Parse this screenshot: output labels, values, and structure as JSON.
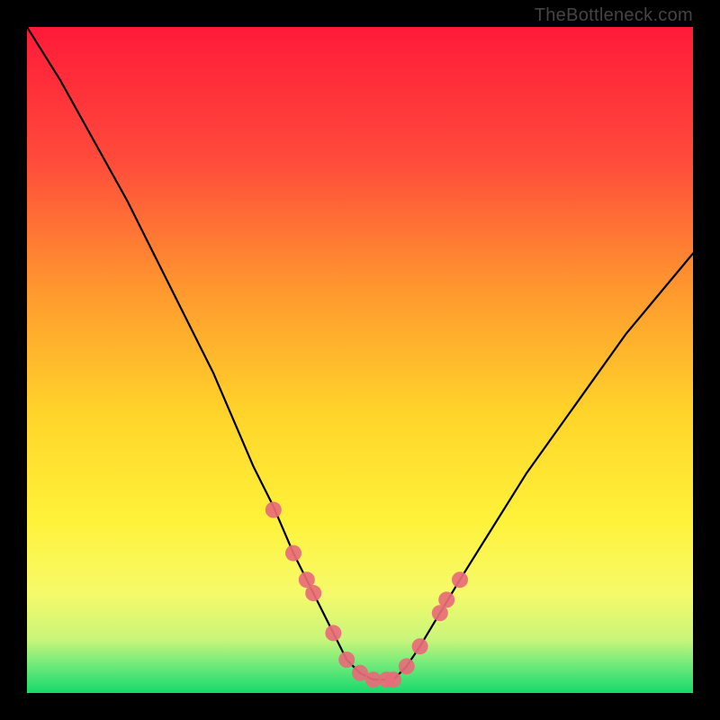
{
  "watermark": "TheBottleneck.com",
  "chart_data": {
    "type": "line",
    "title": "",
    "xlabel": "",
    "ylabel": "",
    "xlim": [
      0,
      100
    ],
    "ylim": [
      0,
      100
    ],
    "series": [
      {
        "name": "bottleneck-curve",
        "x": [
          0,
          5,
          10,
          15,
          20,
          25,
          28,
          31,
          34,
          37,
          40,
          43,
          46,
          48,
          50,
          52,
          54,
          55,
          57,
          59,
          62,
          65,
          70,
          75,
          80,
          85,
          90,
          95,
          100
        ],
        "values": [
          100,
          92,
          83,
          74,
          64,
          54,
          48,
          41,
          34,
          28,
          21,
          15,
          9,
          5,
          3,
          2,
          2,
          2,
          4,
          7,
          12,
          17,
          25,
          33,
          40,
          47,
          54,
          60,
          66
        ]
      }
    ],
    "markers": {
      "name": "highlight-points",
      "x": [
        37,
        40,
        42,
        43,
        46,
        48,
        50,
        52,
        54,
        55,
        57,
        59,
        62,
        63,
        65
      ],
      "values": [
        27.5,
        21,
        17,
        15,
        9,
        5,
        3,
        2,
        2,
        2,
        4,
        7,
        12,
        14,
        17
      ],
      "color": "#e86b78",
      "radius": 9
    },
    "background_gradient": {
      "stops": [
        {
          "offset": 0.0,
          "color": "#ff1a3a"
        },
        {
          "offset": 0.2,
          "color": "#ff4b3b"
        },
        {
          "offset": 0.4,
          "color": "#ff9a2e"
        },
        {
          "offset": 0.58,
          "color": "#ffd42a"
        },
        {
          "offset": 0.74,
          "color": "#fff23a"
        },
        {
          "offset": 0.85,
          "color": "#f6fa6a"
        },
        {
          "offset": 0.92,
          "color": "#c9f57a"
        },
        {
          "offset": 0.96,
          "color": "#6be97a"
        },
        {
          "offset": 1.0,
          "color": "#17d96b"
        }
      ]
    }
  }
}
